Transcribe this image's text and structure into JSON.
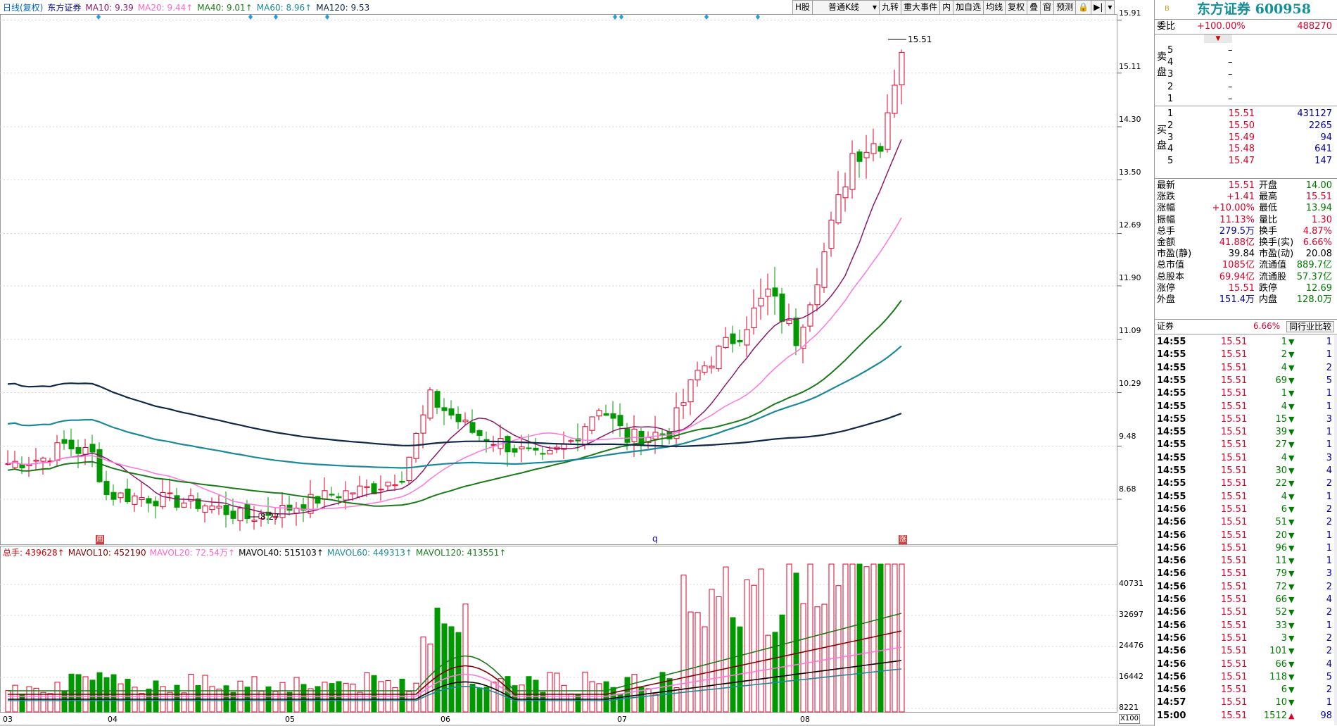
{
  "legend": {
    "title": "日线(复权)",
    "stock": "东方证券",
    "ma10": "MA10: 9.39",
    "ma20": "MA20: 9.44↑",
    "ma40": "MA40: 9.01↑",
    "ma60": "MA60: 8.96↑",
    "ma120": "MA120: 9.53"
  },
  "toolbar": [
    "H股",
    "普通K线",
    "九转",
    "重大事件",
    "内",
    "加自选",
    "均线",
    "复权",
    "叠",
    "窗",
    "预测"
  ],
  "toolbar_icons": [
    "lock-icon",
    "play-end-icon",
    "dropdown-icon"
  ],
  "price_axis": [
    "15.91",
    "15.11",
    "14.30",
    "13.50",
    "12.69",
    "11.90",
    "11.09",
    "10.29",
    "9.48",
    "8.68"
  ],
  "annotations": {
    "high": "15.51",
    "low": "8.27"
  },
  "markers": {
    "m1": "周",
    "m2": "q",
    "m3": "涨"
  },
  "vol_legend": {
    "zongshou": "总手: 439628↑",
    "mavol10": "MAVOL10: 452190",
    "mavol20": "MAVOL20: 72.54万↑",
    "mavol40": "MAVOL40: 515103↑",
    "mavol60": "MAVOL60: 449313↑",
    "mavol120": "MAVOL120: 413551↑"
  },
  "vol_axis": [
    "40731",
    "32697",
    "24476",
    "16442",
    "8221"
  ],
  "vol_unit": "X100",
  "date_axis": [
    "03",
    "04",
    "05",
    "06",
    "07",
    "08"
  ],
  "panel": {
    "header": {
      "code_prefix": "B",
      "name": "东方证券 600958"
    },
    "weibi": {
      "label": "委比",
      "pct": "+100.00%",
      "val": "488270"
    },
    "sell_label": "卖盘",
    "buy_label": "买盘",
    "sell": [
      {
        "n": "5",
        "p": "–",
        "v": ""
      },
      {
        "n": "4",
        "p": "–",
        "v": ""
      },
      {
        "n": "3",
        "p": "–",
        "v": ""
      },
      {
        "n": "2",
        "p": "–",
        "v": ""
      },
      {
        "n": "1",
        "p": "–",
        "v": ""
      }
    ],
    "buy": [
      {
        "n": "1",
        "p": "15.51",
        "v": "431127"
      },
      {
        "n": "2",
        "p": "15.50",
        "v": "2265"
      },
      {
        "n": "3",
        "p": "15.49",
        "v": "94"
      },
      {
        "n": "4",
        "p": "15.48",
        "v": "641"
      },
      {
        "n": "5",
        "p": "15.47",
        "v": "147"
      }
    ],
    "stats": [
      {
        "l1": "最新",
        "v1": "15.51",
        "l2": "开盘",
        "v2": "14.00"
      },
      {
        "l1": "涨跌",
        "v1": "+1.41",
        "l2": "最高",
        "v2": "15.51"
      },
      {
        "l1": "涨幅",
        "v1": "+10.00%",
        "l2": "最低",
        "v2": "13.94"
      },
      {
        "l1": "振幅",
        "v1": "11.13%",
        "l2": "量比",
        "v2": "1.30"
      },
      {
        "l1": "总手",
        "v1": "279.5万",
        "l2": "换手",
        "v2": "4.87%"
      },
      {
        "l1": "金额",
        "v1": "41.88亿",
        "l2": "换手(实)",
        "v2": "6.66%"
      },
      {
        "l1": "市盈(静)",
        "v1": "39.84",
        "l2": "市盈(动)",
        "v2": "20.08"
      },
      {
        "l1": "总市值",
        "v1": "1085亿",
        "l2": "流通值",
        "v2": "889.7亿"
      },
      {
        "l1": "总股本",
        "v1": "69.94亿",
        "l2": "流通股",
        "v2": "57.37亿"
      },
      {
        "l1": "涨停",
        "v1": "15.51",
        "l2": "跌停",
        "v2": "12.69"
      },
      {
        "l1": "外盘",
        "v1": "151.4万",
        "l2": "内盘",
        "v2": "128.0万"
      }
    ],
    "industry": {
      "name": "证券",
      "pct": "6.66%",
      "btn": "同行业比较"
    },
    "ticks": [
      {
        "t": "14:55",
        "p": "15.51",
        "v": "1",
        "d": "down",
        "n": "1"
      },
      {
        "t": "14:55",
        "p": "15.51",
        "v": "2",
        "d": "down",
        "n": "1"
      },
      {
        "t": "14:55",
        "p": "15.51",
        "v": "4",
        "d": "down",
        "n": "2"
      },
      {
        "t": "14:55",
        "p": "15.51",
        "v": "69",
        "d": "down",
        "n": "5"
      },
      {
        "t": "14:55",
        "p": "15.51",
        "v": "1",
        "d": "down",
        "n": "1"
      },
      {
        "t": "14:55",
        "p": "15.51",
        "v": "4",
        "d": "down",
        "n": "1"
      },
      {
        "t": "14:55",
        "p": "15.51",
        "v": "15",
        "d": "down",
        "n": "3"
      },
      {
        "t": "14:55",
        "p": "15.51",
        "v": "39",
        "d": "down",
        "n": "1"
      },
      {
        "t": "14:55",
        "p": "15.51",
        "v": "27",
        "d": "down",
        "n": "1"
      },
      {
        "t": "14:55",
        "p": "15.51",
        "v": "4",
        "d": "down",
        "n": "3"
      },
      {
        "t": "14:55",
        "p": "15.51",
        "v": "30",
        "d": "down",
        "n": "4"
      },
      {
        "t": "14:55",
        "p": "15.51",
        "v": "22",
        "d": "down",
        "n": "2"
      },
      {
        "t": "14:55",
        "p": "15.51",
        "v": "4",
        "d": "down",
        "n": "1"
      },
      {
        "t": "14:56",
        "p": "15.51",
        "v": "6",
        "d": "down",
        "n": "2"
      },
      {
        "t": "14:56",
        "p": "15.51",
        "v": "51",
        "d": "down",
        "n": "2"
      },
      {
        "t": "14:56",
        "p": "15.51",
        "v": "20",
        "d": "down",
        "n": "1"
      },
      {
        "t": "14:56",
        "p": "15.51",
        "v": "96",
        "d": "down",
        "n": "1"
      },
      {
        "t": "14:56",
        "p": "15.51",
        "v": "11",
        "d": "down",
        "n": "1"
      },
      {
        "t": "14:56",
        "p": "15.51",
        "v": "79",
        "d": "down",
        "n": "3"
      },
      {
        "t": "14:56",
        "p": "15.51",
        "v": "72",
        "d": "down",
        "n": "2"
      },
      {
        "t": "14:56",
        "p": "15.51",
        "v": "66",
        "d": "down",
        "n": "4"
      },
      {
        "t": "14:56",
        "p": "15.51",
        "v": "52",
        "d": "down",
        "n": "2"
      },
      {
        "t": "14:56",
        "p": "15.51",
        "v": "33",
        "d": "down",
        "n": "1"
      },
      {
        "t": "14:56",
        "p": "15.51",
        "v": "3",
        "d": "down",
        "n": "2"
      },
      {
        "t": "14:56",
        "p": "15.51",
        "v": "101",
        "d": "down",
        "n": "2"
      },
      {
        "t": "14:56",
        "p": "15.51",
        "v": "66",
        "d": "down",
        "n": "4"
      },
      {
        "t": "14:56",
        "p": "15.51",
        "v": "118",
        "d": "down",
        "n": "5"
      },
      {
        "t": "14:56",
        "p": "15.51",
        "v": "6",
        "d": "down",
        "n": "2"
      },
      {
        "t": "14:57",
        "p": "15.51",
        "v": "10",
        "d": "down",
        "n": "1"
      },
      {
        "t": "15:00",
        "p": "15.51",
        "v": "1512",
        "d": "up",
        "n": "98"
      }
    ]
  },
  "colors": {
    "up": "#e0002a",
    "down": "#009a00",
    "ma10": "#8b1a6b",
    "ma20": "#ff77dd",
    "ma40": "#1a7a1a",
    "ma60": "#1a8a9a",
    "ma120": "#102848",
    "grid": "#d8d8d8",
    "markers": "#2a9ad8"
  }
}
